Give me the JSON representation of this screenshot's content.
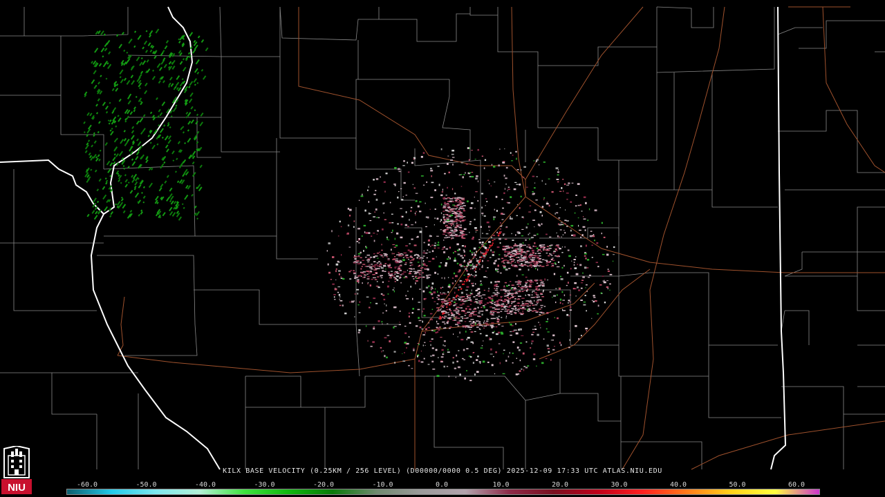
{
  "product": {
    "station": "KILX",
    "product_name": "BASE VELOCITY",
    "resolution": "(0.25KM / 256 LEVEL)",
    "volume": "(D00000/0000",
    "elevation": "0.5 DEG)",
    "datetime": "2025-12-09 17:33 UTC",
    "source": "ATLAS.NIU.EDU"
  },
  "colorbar": {
    "labels": [
      "-60.0",
      "-50.0",
      "-40.0",
      "-30.0",
      "-20.0",
      "-10.0",
      "0.0",
      "10.0",
      "20.0",
      "30.0",
      "40.0",
      "50.0",
      "60.0"
    ],
    "units": "",
    "stops": [
      "#0e5f6e",
      "#22c9e8",
      "#7de8ef",
      "#b3f0d6",
      "#3fe33f",
      "#0fb80f",
      "#0a7a0a",
      "#6f8a6f",
      "#9b9b9b",
      "#b3a3ad",
      "#8d2a48",
      "#7a1020",
      "#c0001a",
      "#ff2020",
      "#ff7a1a",
      "#ffd21a",
      "#ffff40",
      "#cc33cc"
    ]
  },
  "logo": {
    "text": "NIU",
    "color": "#c8102e"
  },
  "colors": {
    "county_lines": "#8a8a8a",
    "state_lines": "#ffffff",
    "highways": "#a0522d",
    "inbound": "#2aa82a",
    "outbound": "#c0506a"
  }
}
